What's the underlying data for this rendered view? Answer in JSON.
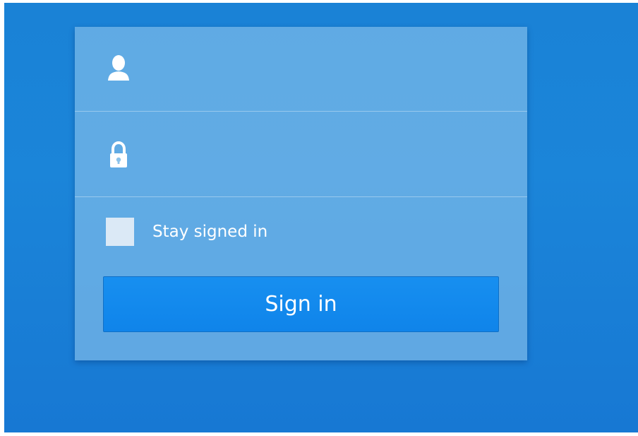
{
  "login": {
    "username_icon": "user-icon",
    "password_icon": "lock-icon",
    "username_value": "",
    "password_value": "",
    "stay_signed_in_label": "Stay signed in",
    "stay_signed_in_checked": false,
    "sign_in_label": "Sign in"
  },
  "colors": {
    "background": "#1a82d6",
    "card": "#8cc3eb",
    "button": "#178ff0",
    "text": "#ffffff"
  }
}
